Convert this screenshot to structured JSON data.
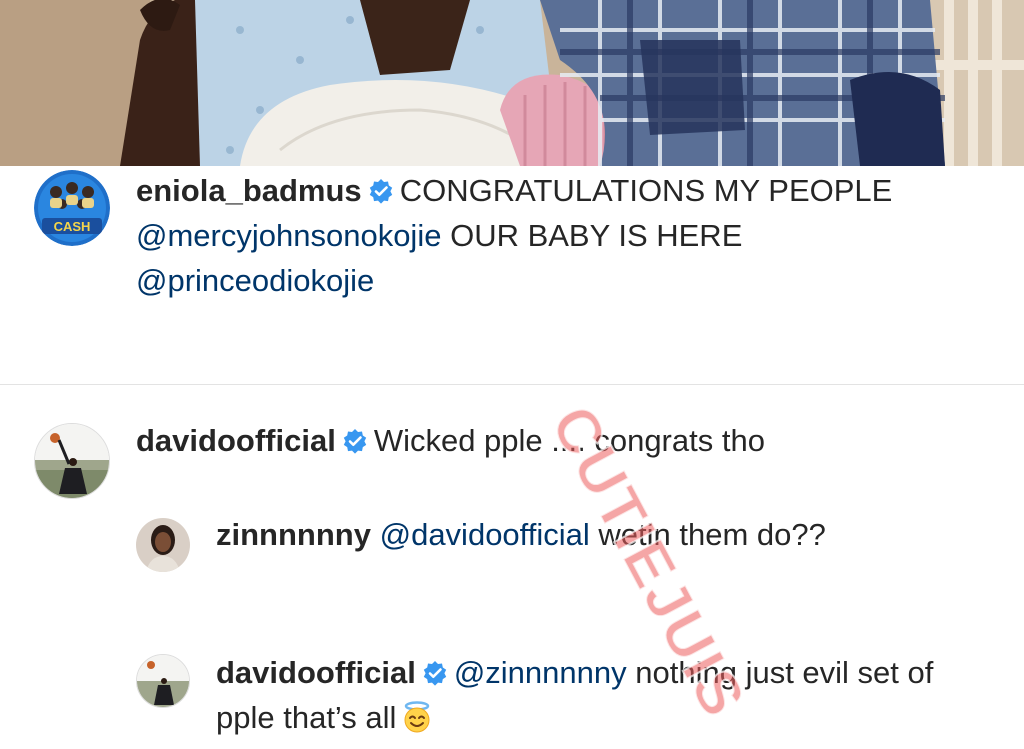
{
  "post": {
    "caption": {
      "username": "eniola_badmus",
      "text_1": "CONGRATULATIONS MY PEOPLE",
      "mention_1": "@mercyjohnsonokojie",
      "text_2": "OUR BABY IS HERE",
      "mention_2": "@princeodiokojie",
      "avatar_label": "CASH"
    }
  },
  "comments": [
    {
      "username": "davidoofficial",
      "text": "Wicked pple .... congrats tho"
    }
  ],
  "replies": [
    {
      "username": "zinnnnnny",
      "mention": "@davidoofficial",
      "text": "wetin them do??"
    },
    {
      "username": "davidoofficial",
      "mention": "@zinnnnnny",
      "text": "nothing just evil set of pple that’s all",
      "emoji": "smiling-face-with-halo"
    }
  ],
  "watermark": {
    "text": "CUTIEJUIS"
  },
  "colors": {
    "text": "#262626",
    "mention": "#003569",
    "verified_badge": "#3897f0",
    "divider": "#e3e3e3",
    "watermark": "#ec5c5c"
  }
}
